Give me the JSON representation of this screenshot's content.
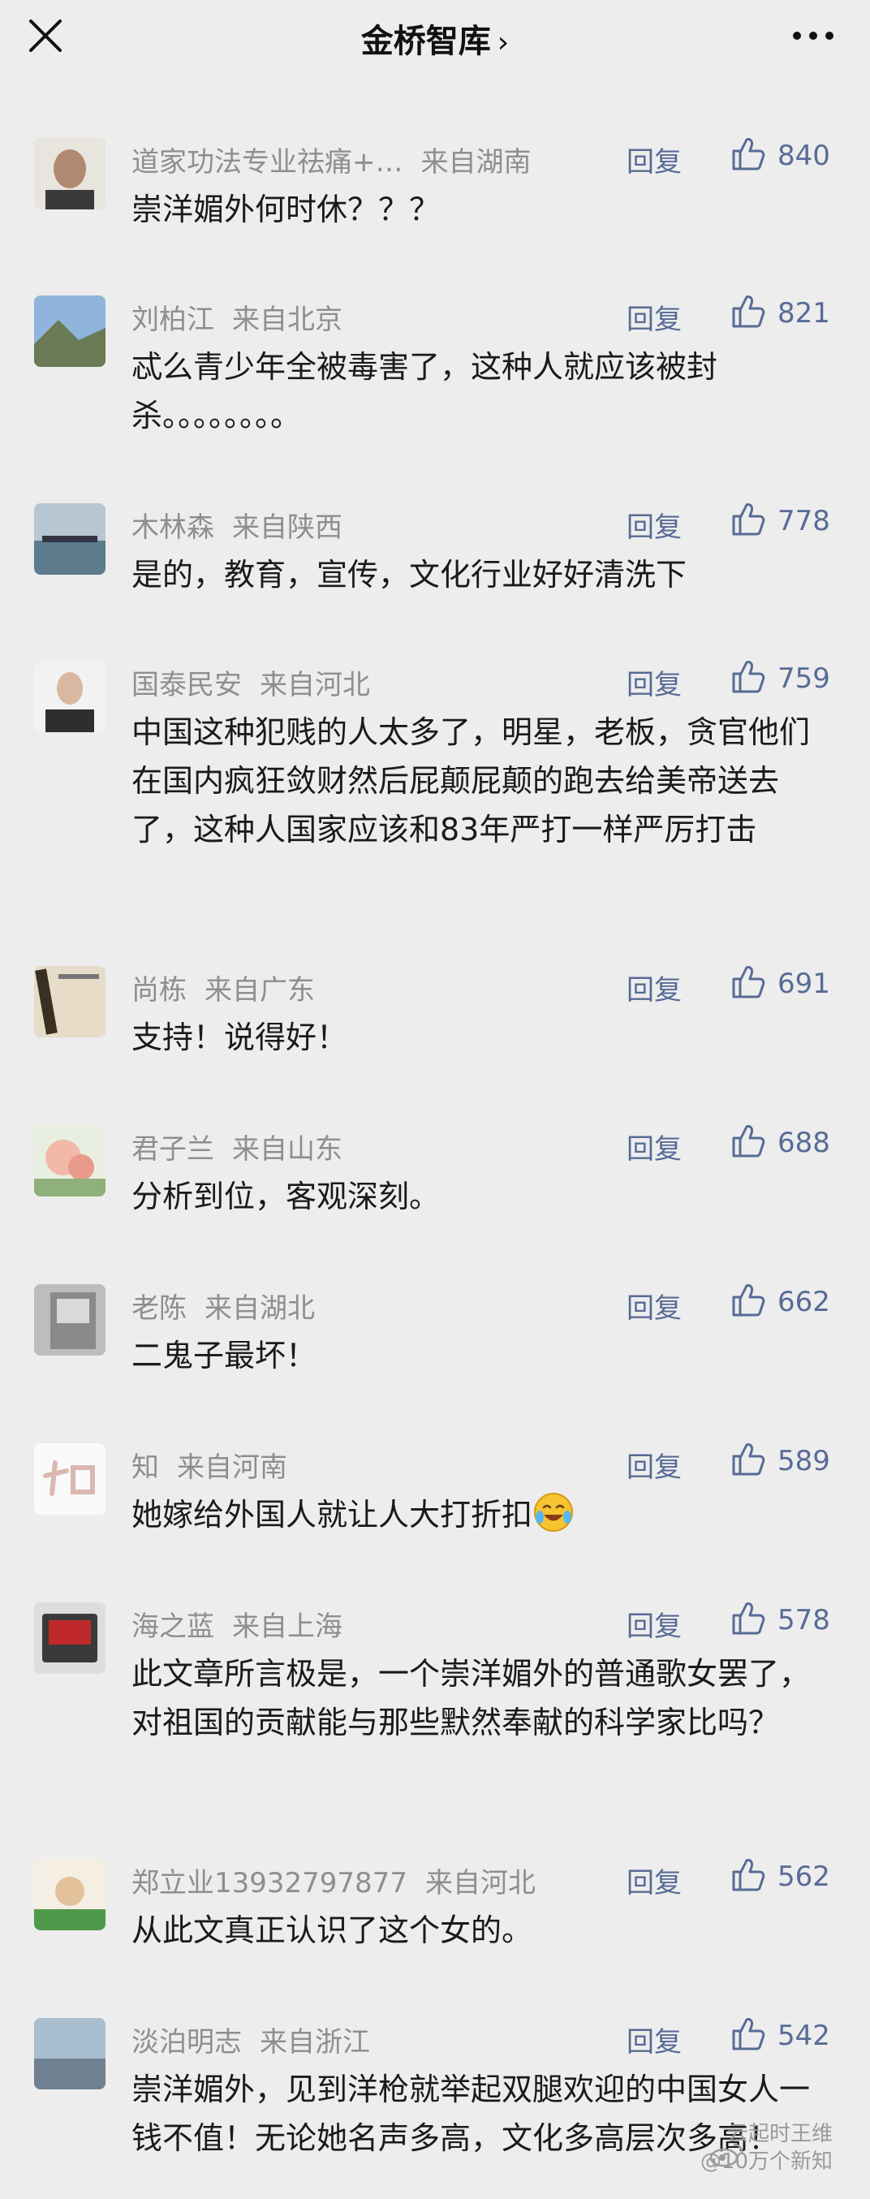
{
  "header": {
    "title": "金桥智库",
    "chevron": "›",
    "close_icon": "close-icon",
    "more_icon": "more-icon"
  },
  "comments": [
    {
      "user": "道家功法专业祛痛+…",
      "location": "来自湖南",
      "reply": "回复",
      "likes": "840",
      "text": "崇洋媚外何时休？？？"
    },
    {
      "user": "刘柏江",
      "location": "来自北京",
      "reply": "回复",
      "likes": "821",
      "text": "忒么青少年全被毒害了，这种人就应该被封杀。。。。。。。。"
    },
    {
      "user": "木林森",
      "location": "来自陕西",
      "reply": "回复",
      "likes": "778",
      "text": "是的，教育，宣传，文化行业好好清洗下"
    },
    {
      "user": "国泰民安",
      "location": "来自河北",
      "reply": "回复",
      "likes": "759",
      "text": "中国这种犯贱的人太多了，明星，老板，贪官他们在国内疯狂敛财然后屁颠屁颠的跑去给美帝送去了，这种人国家应该和83年严打一样严厉打击"
    },
    {
      "user": "尚栋",
      "location": "来自广东",
      "reply": "回复",
      "likes": "691",
      "text": "支持！说得好！"
    },
    {
      "user": "君子兰",
      "location": "来自山东",
      "reply": "回复",
      "likes": "688",
      "text": "分析到位，客观深刻。"
    },
    {
      "user": "老陈",
      "location": "来自湖北",
      "reply": "回复",
      "likes": "662",
      "text": "二鬼子最坏！"
    },
    {
      "user": "知",
      "location": "来自河南",
      "reply": "回复",
      "likes": "589",
      "text": "她嫁给外国人就让人大打折扣"
    },
    {
      "user": "海之蓝",
      "location": "来自上海",
      "reply": "回复",
      "likes": "578",
      "text": "此文章所言极是，一个崇洋媚外的普通歌女罢了，对祖国的贡献能与那些默然奉献的科学家比吗？"
    },
    {
      "user": "郑立业13932797877",
      "location": "来自河北",
      "reply": "回复",
      "likes": "562",
      "text": "从此文真正认识了这个女的。"
    },
    {
      "user": "淡泊明志",
      "location": "来自浙江",
      "reply": "回复",
      "likes": "542",
      "text": "崇洋媚外，见到洋枪就举起双腿欢迎的中国女人一钱不值！无论她名声多高，文化多高层次多高！"
    }
  ],
  "watermark": {
    "line1": "云起时王维",
    "line2": "@10万个新知"
  },
  "colors": {
    "background": "#ededed",
    "link": "#576b95",
    "username": "#8e8e8e",
    "text": "#1a1a1a"
  }
}
